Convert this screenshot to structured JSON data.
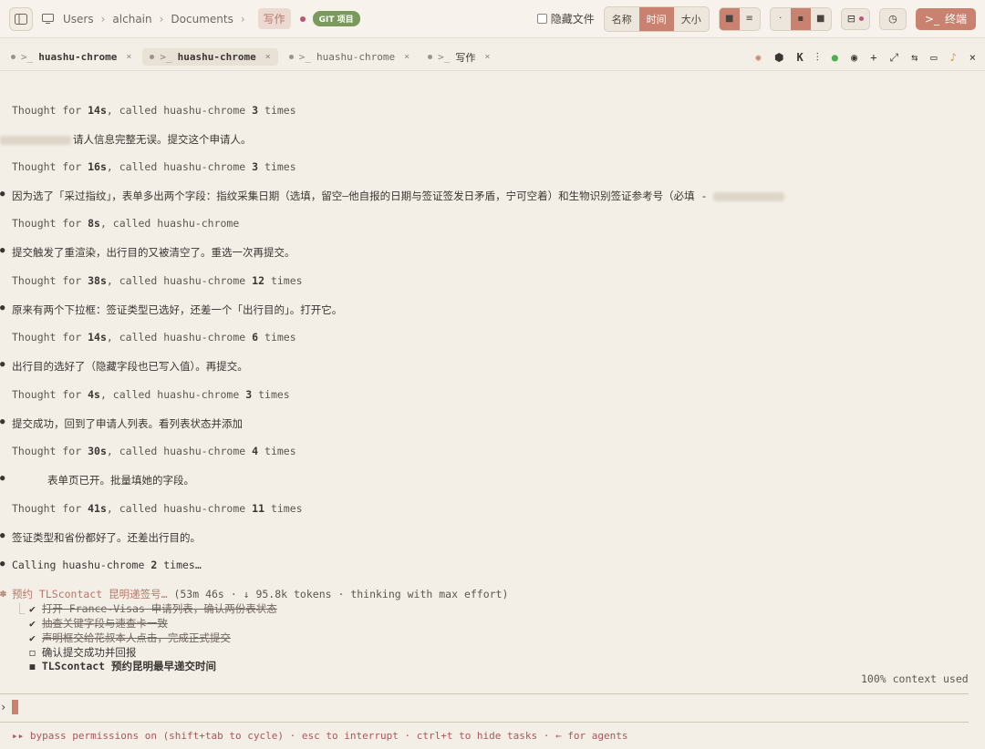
{
  "topbar": {
    "breadcrumb": [
      "Users",
      "alchain",
      "Documents"
    ],
    "active_crumb": "写作",
    "git_badge": "GIT 项目",
    "hide_files_label": "隐藏文件",
    "sort": [
      "名称",
      "时间",
      "大小"
    ],
    "sort_selected": "时间",
    "terminal_label": "终端"
  },
  "tabs": [
    {
      "label": "huashu-chrome",
      "active": false
    },
    {
      "label": "huashu-chrome",
      "active": true
    },
    {
      "label": "huashu-chrome",
      "active": false
    },
    {
      "label": "写作",
      "active": false
    }
  ],
  "log": [
    {
      "type": "thought",
      "secs": "14s",
      "tool": "huashu-chrome",
      "count": "3",
      "suffix": "times"
    },
    {
      "type": "message",
      "text": "请人信息完整无误。提交这个申请人。"
    },
    {
      "type": "thought",
      "secs": "16s",
      "tool": "huashu-chrome",
      "count": "3",
      "suffix": "times"
    },
    {
      "type": "message",
      "text": "因为选了「采过指纹」，表单多出两个字段：指纹采集日期（选填，留空—他自报的日期与签证签发日矛盾，宁可空着）和生物识别签证参考号（必填 -"
    },
    {
      "type": "thought",
      "secs": "8s",
      "tool": "huashu-chrome"
    },
    {
      "type": "message",
      "text": "提交触发了重渲染，出行目的又被清空了。重选一次再提交。"
    },
    {
      "type": "thought",
      "secs": "38s",
      "tool": "huashu-chrome",
      "count": "12",
      "suffix": "times"
    },
    {
      "type": "message",
      "text": "原来有两个下拉框：签证类型已选好，还差一个「出行目的」。打开它。"
    },
    {
      "type": "thought",
      "secs": "14s",
      "tool": "huashu-chrome",
      "count": "6",
      "suffix": "times"
    },
    {
      "type": "message",
      "text": "出行目的选好了（隐藏字段也已写入值）。再提交。"
    },
    {
      "type": "thought",
      "secs": "4s",
      "tool": "huashu-chrome",
      "count": "3",
      "suffix": "times"
    },
    {
      "type": "message",
      "text": "提交成功，回到了申请人列表。看列表状态并添加"
    },
    {
      "type": "thought",
      "secs": "30s",
      "tool": "huashu-chrome",
      "count": "4",
      "suffix": "times"
    },
    {
      "type": "message",
      "text": "表单页已开。批量填她的字段。"
    },
    {
      "type": "thought",
      "secs": "41s",
      "tool": "huashu-chrome",
      "count": "11",
      "suffix": "times"
    },
    {
      "type": "message",
      "text": "签证类型和省份都好了。还差出行目的。"
    },
    {
      "type": "calling",
      "tool": "huashu-chrome",
      "count": "2",
      "suffix": "times…"
    }
  ],
  "status": {
    "prefix": "预约 TLScontact 昆明递签号…",
    "stats": "(53m 46s · ↓ 95.8k tokens · thinking with max effort)"
  },
  "tasks": [
    {
      "mark": "✔",
      "text": "打开 France-Visas 申请列表，确认两份表状态",
      "done": true
    },
    {
      "mark": "✔",
      "text": "抽查关键字段与速查卡一致",
      "done": true
    },
    {
      "mark": "✔",
      "text": "声明框交给花叔本人点击，完成正式提交",
      "done": true
    },
    {
      "mark": "◻",
      "text": "确认提交成功并回报",
      "done": false
    },
    {
      "mark": "◼",
      "text": "TLScontact 预约昆明最早递交时间",
      "done": false,
      "current": true
    }
  ],
  "context_used": "100% context used",
  "footer": "▸▸ bypass permissions on (shift+tab to cycle) · esc to interrupt · ctrl+t to hide tasks · ← for agents",
  "colors": {
    "accent": "#c9826f",
    "bg": "#f4efe6",
    "git": "#7a9a5d"
  }
}
